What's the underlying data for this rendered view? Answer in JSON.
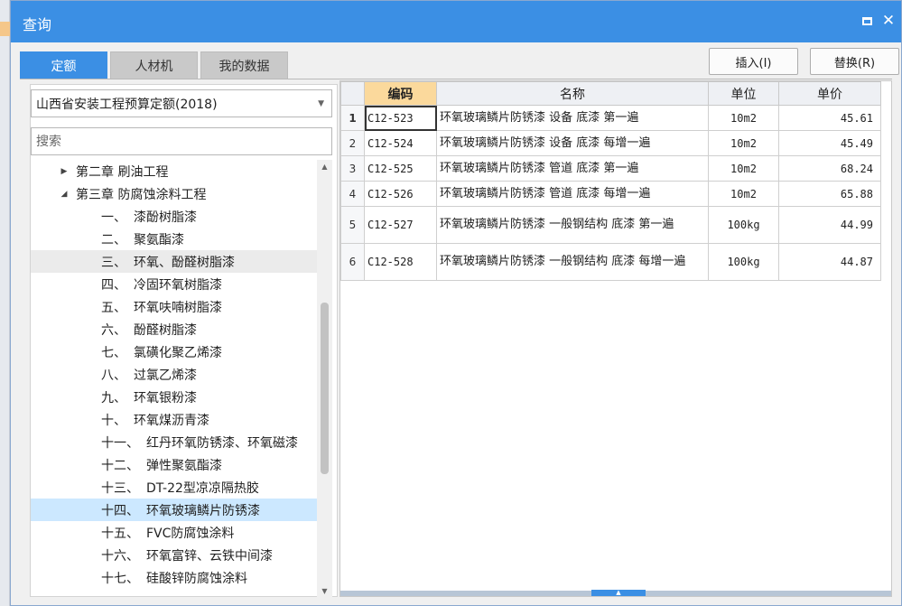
{
  "window": {
    "title": "查询"
  },
  "tabs": [
    {
      "label": "定额",
      "active": true
    },
    {
      "label": "人材机",
      "active": false
    },
    {
      "label": "我的数据",
      "active": false
    }
  ],
  "toolbar": {
    "insert_label": "插入(I)",
    "replace_label": "替换(R)"
  },
  "library": {
    "selected": "山西省安装工程预算定额(2018)"
  },
  "search": {
    "placeholder": "搜索"
  },
  "tree": {
    "chapters": [
      {
        "label": "第二章 刷油工程",
        "expanded": false
      },
      {
        "label": "第三章 防腐蚀涂料工程",
        "expanded": true
      }
    ],
    "sections": [
      {
        "num": "一、",
        "label": "漆酚树脂漆"
      },
      {
        "num": "二、",
        "label": "聚氨酯漆"
      },
      {
        "num": "三、",
        "label": "环氧、酚醛树脂漆"
      },
      {
        "num": "四、",
        "label": "冷固环氧树脂漆"
      },
      {
        "num": "五、",
        "label": "环氧呋喃树脂漆"
      },
      {
        "num": "六、",
        "label": "酚醛树脂漆"
      },
      {
        "num": "七、",
        "label": "氯磺化聚乙烯漆"
      },
      {
        "num": "八、",
        "label": "过氯乙烯漆"
      },
      {
        "num": "九、",
        "label": "环氧银粉漆"
      },
      {
        "num": "十、",
        "label": "环氧煤沥青漆"
      },
      {
        "num": "十一、",
        "label": "红丹环氧防锈漆、环氧磁漆"
      },
      {
        "num": "十二、",
        "label": "弹性聚氨酯漆"
      },
      {
        "num": "十三、",
        "label": "DT-22型凉凉隔热胶"
      },
      {
        "num": "十四、",
        "label": "环氧玻璃鳞片防锈漆"
      },
      {
        "num": "十五、",
        "label": "FVC防腐蚀涂料"
      },
      {
        "num": "十六、",
        "label": "环氧富锌、云铁中间漆"
      },
      {
        "num": "十七、",
        "label": "硅酸锌防腐蚀涂料"
      }
    ]
  },
  "grid": {
    "columns": {
      "code": "编码",
      "name": "名称",
      "unit": "单位",
      "price": "单价"
    },
    "rows": [
      {
        "idx": "1",
        "code": "C12-523",
        "name": "环氧玻璃鳞片防锈漆 设备 底漆 第一遍",
        "unit": "10m2",
        "price": "45.61"
      },
      {
        "idx": "2",
        "code": "C12-524",
        "name": "环氧玻璃鳞片防锈漆 设备 底漆 每增一遍",
        "unit": "10m2",
        "price": "45.49"
      },
      {
        "idx": "3",
        "code": "C12-525",
        "name": "环氧玻璃鳞片防锈漆 管道 底漆 第一遍",
        "unit": "10m2",
        "price": "68.24"
      },
      {
        "idx": "4",
        "code": "C12-526",
        "name": "环氧玻璃鳞片防锈漆 管道 底漆 每增一遍",
        "unit": "10m2",
        "price": "65.88"
      },
      {
        "idx": "5",
        "code": "C12-527",
        "name": "环氧玻璃鳞片防锈漆 一般钢结构 底漆 第一遍",
        "unit": "100kg",
        "price": "44.99"
      },
      {
        "idx": "6",
        "code": "C12-528",
        "name": "环氧玻璃鳞片防锈漆 一般钢结构 底漆 每增一遍",
        "unit": "100kg",
        "price": "44.87"
      }
    ]
  },
  "colors": {
    "accent": "#3b8fe4",
    "selected_row": "#cce8ff",
    "sorted_header": "#fbd99c"
  }
}
